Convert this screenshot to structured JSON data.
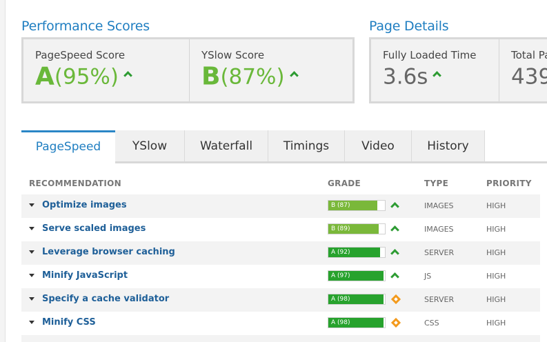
{
  "performance": {
    "title": "Performance Scores",
    "pagespeed": {
      "label": "PageSpeed Score",
      "grade": "A",
      "percent": "(95%)"
    },
    "yslow": {
      "label": "YSlow Score",
      "grade": "B",
      "percent": "(87%)"
    }
  },
  "details": {
    "title": "Page Details",
    "fully_loaded": {
      "label": "Fully Loaded Time",
      "value": "3.6s"
    },
    "total_page": {
      "label": "Total Pa",
      "value": "439"
    }
  },
  "tabs": [
    {
      "label": "PageSpeed",
      "active": true
    },
    {
      "label": "YSlow"
    },
    {
      "label": "Waterfall"
    },
    {
      "label": "Timings"
    },
    {
      "label": "Video"
    },
    {
      "label": "History"
    }
  ],
  "table": {
    "headers": {
      "recommendation": "RECOMMENDATION",
      "grade": "GRADE",
      "type": "TYPE",
      "priority": "PRIORITY"
    },
    "rows": [
      {
        "name": "Optimize images",
        "grade_label": "B (87)",
        "score": 87,
        "bar_color": "#7ab83a",
        "trend": "up",
        "type": "IMAGES",
        "priority": "HIGH"
      },
      {
        "name": "Serve scaled images",
        "grade_label": "B (89)",
        "score": 89,
        "bar_color": "#7ab83a",
        "trend": "up",
        "type": "IMAGES",
        "priority": "HIGH"
      },
      {
        "name": "Leverage browser caching",
        "grade_label": "A (92)",
        "score": 92,
        "bar_color": "#27a22d",
        "trend": "up",
        "type": "SERVER",
        "priority": "HIGH"
      },
      {
        "name": "Minify JavaScript",
        "grade_label": "A (97)",
        "score": 97,
        "bar_color": "#27a22d",
        "trend": "up",
        "type": "JS",
        "priority": "HIGH"
      },
      {
        "name": "Specify a cache validator",
        "grade_label": "A (98)",
        "score": 98,
        "bar_color": "#27a22d",
        "trend": "warning",
        "type": "SERVER",
        "priority": "HIGH"
      },
      {
        "name": "Minify CSS",
        "grade_label": "A (98)",
        "score": 98,
        "bar_color": "#27a22d",
        "trend": "warning",
        "type": "CSS",
        "priority": "HIGH"
      }
    ]
  },
  "colors": {
    "accent": "#1f7ec1",
    "grade_green": "#69b83a",
    "trend_up": "#2d9b32",
    "warning": "#f39a1c"
  },
  "icons": {
    "trend_up": "chevron-up-icon",
    "warning": "warning-diamond-icon",
    "expand": "caret-down-icon"
  }
}
